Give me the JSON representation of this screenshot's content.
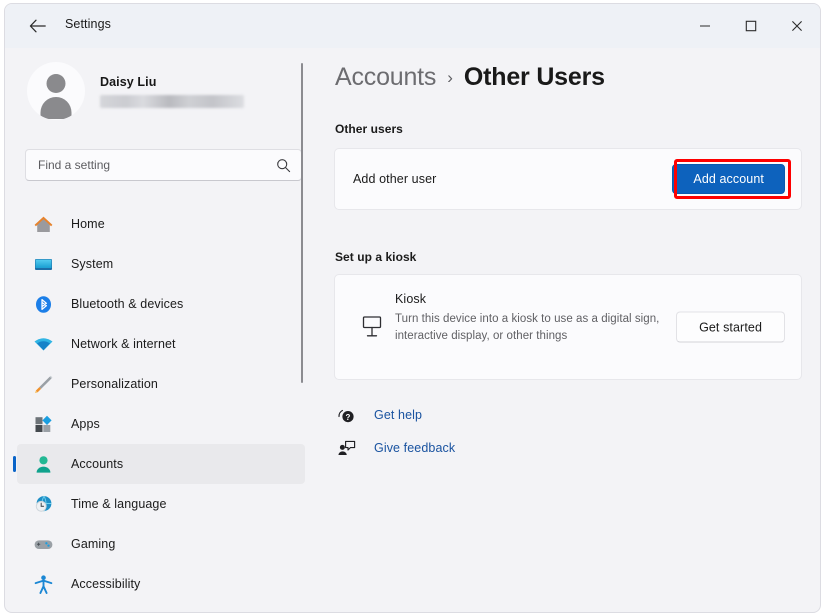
{
  "window": {
    "app_title": "Settings",
    "back_icon": "back-arrow-icon",
    "minimize_label": "—",
    "maximize_label": "□",
    "close_label": "✕"
  },
  "sidebar": {
    "profile": {
      "name": "Daisy Liu",
      "email_redacted": true,
      "avatar_icon": "user-avatar-icon"
    },
    "search": {
      "placeholder": "Find a setting",
      "value": "",
      "icon": "search-icon"
    },
    "items": [
      {
        "label": "Home",
        "icon": "home-icon",
        "selected": false
      },
      {
        "label": "System",
        "icon": "system-icon",
        "selected": false
      },
      {
        "label": "Bluetooth & devices",
        "icon": "bluetooth-icon",
        "selected": false
      },
      {
        "label": "Network & internet",
        "icon": "wifi-icon",
        "selected": false
      },
      {
        "label": "Personalization",
        "icon": "paintbrush-icon",
        "selected": false
      },
      {
        "label": "Apps",
        "icon": "apps-icon",
        "selected": false
      },
      {
        "label": "Accounts",
        "icon": "accounts-person-icon",
        "selected": true
      },
      {
        "label": "Time & language",
        "icon": "clock-globe-icon",
        "selected": false
      },
      {
        "label": "Gaming",
        "icon": "gamepad-icon",
        "selected": false
      },
      {
        "label": "Accessibility",
        "icon": "accessibility-person-icon",
        "selected": false
      }
    ]
  },
  "main": {
    "breadcrumb": {
      "parent": "Accounts",
      "separator": "›",
      "current": "Other Users"
    },
    "other_users": {
      "section_title": "Other users",
      "row_label": "Add other user",
      "button_label": "Add account",
      "button_highlighted": true
    },
    "kiosk": {
      "section_title": "Set up a kiosk",
      "icon": "kiosk-display-icon",
      "title": "Kiosk",
      "description": "Turn this device into a kiosk to use as a digital sign, interactive display, or other things",
      "button_label": "Get started"
    },
    "links": [
      {
        "label": "Get help",
        "icon": "get-help-icon"
      },
      {
        "label": "Give feedback",
        "icon": "give-feedback-icon"
      }
    ]
  },
  "colors": {
    "accent": "#0d62bd",
    "highlight": "#fe0000",
    "link": "#1a53a0",
    "window_bg": "#f3f3f6",
    "titlebar_bg": "#eef1f6",
    "card_bg": "#fbfbfd",
    "selected_nav_bg": "#e9e9ec",
    "nav_pill": "#0a64c8"
  }
}
